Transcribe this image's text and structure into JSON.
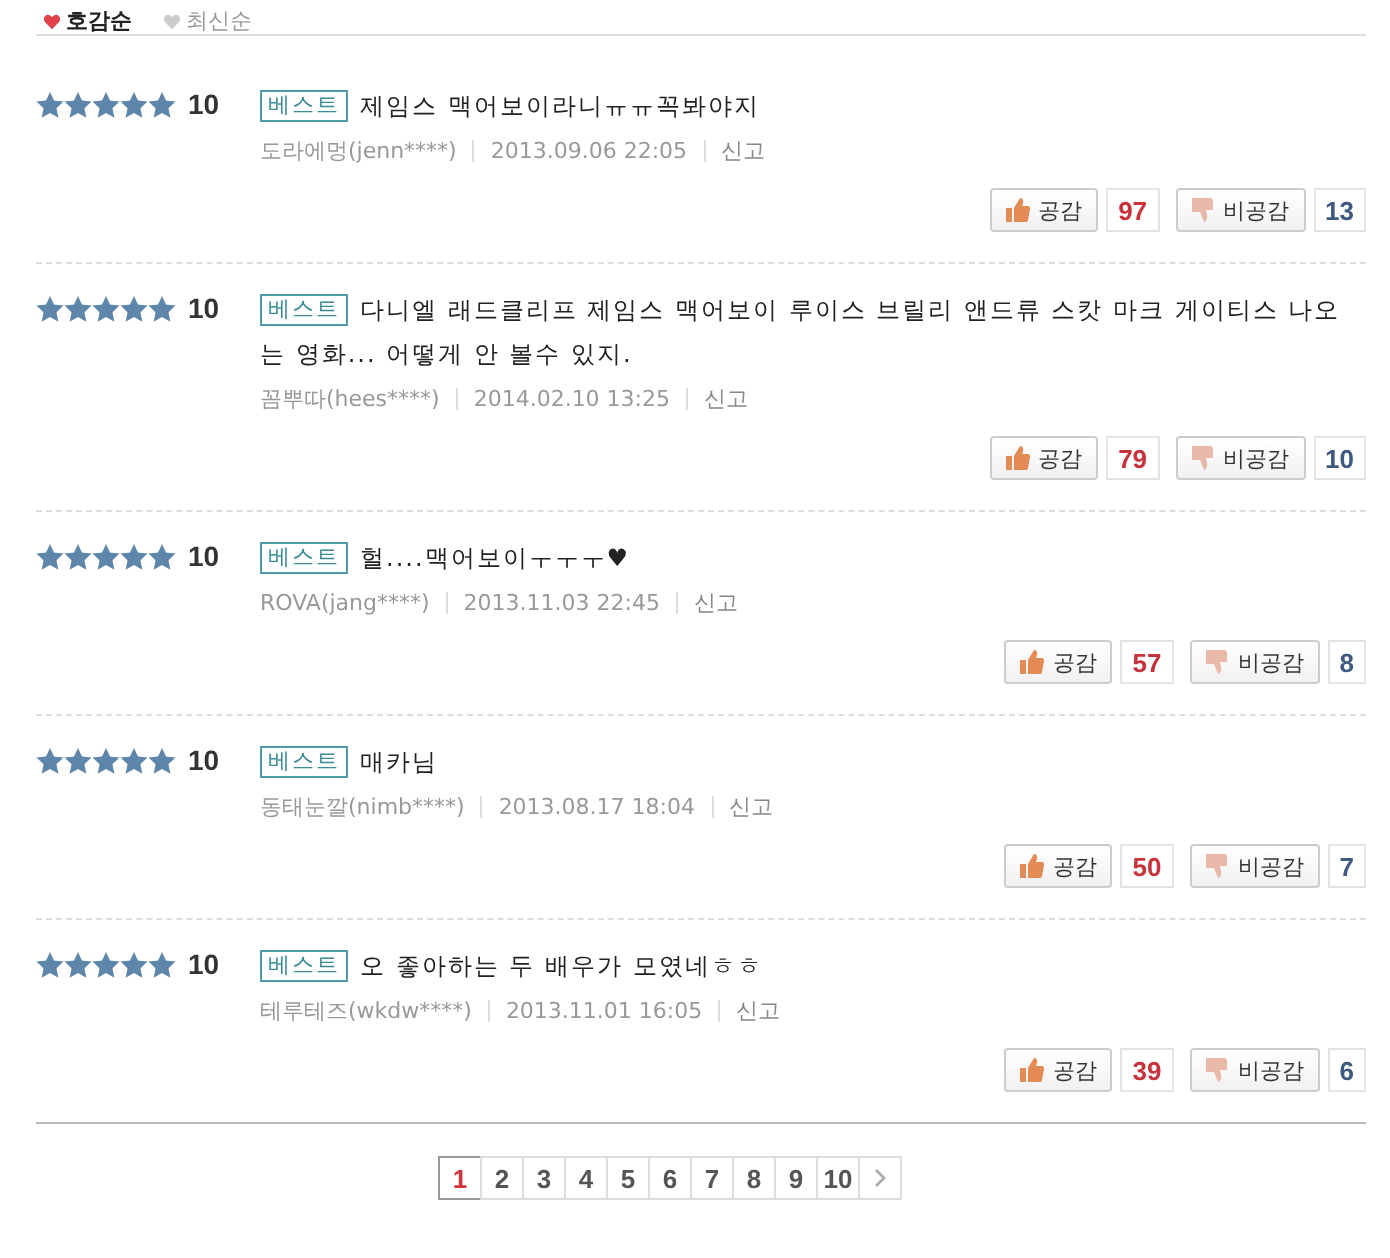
{
  "sort_options": [
    {
      "label": "호감순",
      "selected": true
    },
    {
      "label": "최신순",
      "selected": false
    }
  ],
  "reviews": [
    {
      "stars": 5,
      "score": "10",
      "badge": "베스트",
      "text": "제임스 맥어보이라니ㅠㅠ꼭봐야지",
      "author": "도라에멍(jenn****)",
      "date": "2013.09.06 22:05",
      "report": "신고",
      "like_label": "공감",
      "like_count": "97",
      "dislike_label": "비공감",
      "dislike_count": "13"
    },
    {
      "stars": 5,
      "score": "10",
      "badge": "베스트",
      "text": "다니엘 래드클리프 제임스 맥어보이 루이스 브릴리 앤드류 스캇 마크 게이티스 나오는 영화... 어떻게 안 볼수 있지.",
      "author": "꼼뿌따(hees****)",
      "date": "2014.02.10 13:25",
      "report": "신고",
      "like_label": "공감",
      "like_count": "79",
      "dislike_label": "비공감",
      "dislike_count": "10"
    },
    {
      "stars": 5,
      "score": "10",
      "badge": "베스트",
      "text": "헐....맥어보이ㅜㅜㅜ♥",
      "author": "ROVA(jang****)",
      "date": "2013.11.03 22:45",
      "report": "신고",
      "like_label": "공감",
      "like_count": "57",
      "dislike_label": "비공감",
      "dislike_count": "8"
    },
    {
      "stars": 5,
      "score": "10",
      "badge": "베스트",
      "text": "매카님",
      "author": "동태눈깔(nimb****)",
      "date": "2013.08.17 18:04",
      "report": "신고",
      "like_label": "공감",
      "like_count": "50",
      "dislike_label": "비공감",
      "dislike_count": "7"
    },
    {
      "stars": 5,
      "score": "10",
      "badge": "베스트",
      "text": "오 좋아하는 두 배우가 모였네ㅎㅎ",
      "author": "테루테즈(wkdw****)",
      "date": "2013.11.01 16:05",
      "report": "신고",
      "like_label": "공감",
      "like_count": "39",
      "dislike_label": "비공감",
      "dislike_count": "6"
    }
  ],
  "pagination": [
    {
      "label": "1",
      "selected": true
    },
    {
      "label": "2",
      "selected": false
    },
    {
      "label": "3",
      "selected": false
    },
    {
      "label": "4",
      "selected": false
    },
    {
      "label": "5",
      "selected": false
    },
    {
      "label": "6",
      "selected": false
    },
    {
      "label": "7",
      "selected": false
    },
    {
      "label": "8",
      "selected": false
    },
    {
      "label": "9",
      "selected": false
    },
    {
      "label": "10",
      "selected": false
    }
  ]
}
